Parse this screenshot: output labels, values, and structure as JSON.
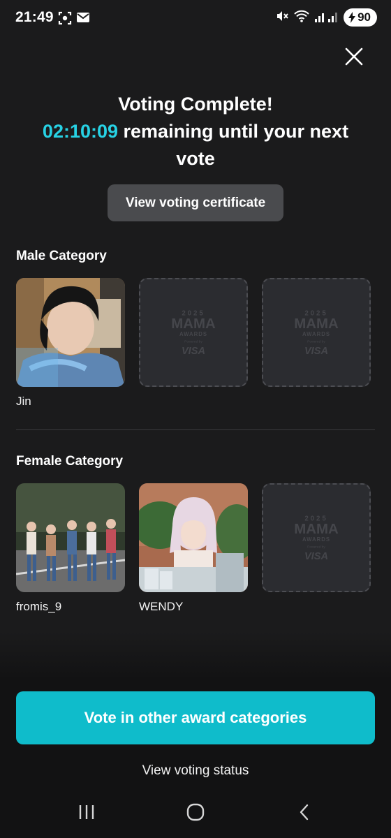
{
  "status_bar": {
    "time": "21:49",
    "battery": "90",
    "icons": [
      "screenshot-icon",
      "mail-icon",
      "mute-icon",
      "wifi-icon",
      "signal-icon",
      "battery-icon"
    ]
  },
  "result": {
    "heading": "Voting Complete!",
    "countdown": "02:10:09",
    "countdown_suffix": " remaining until your next vote",
    "certificate_button": "View voting certificate"
  },
  "categories": {
    "male": {
      "title": "Male Category",
      "selected": [
        "Jin"
      ]
    },
    "female": {
      "title": "Female Category",
      "selected": [
        "fromis_9",
        "WENDY"
      ]
    }
  },
  "placeholder_logo": {
    "year": "2025",
    "brand": "MAMA",
    "awards": "AWARDS",
    "powered": "Powered by",
    "sponsor": "VISA"
  },
  "actions": {
    "vote_other": "Vote in other award categories",
    "view_status": "View voting status"
  },
  "colors": {
    "accent": "#0fbccb",
    "countdown": "#27d2e4",
    "background": "#1b1b1c"
  }
}
